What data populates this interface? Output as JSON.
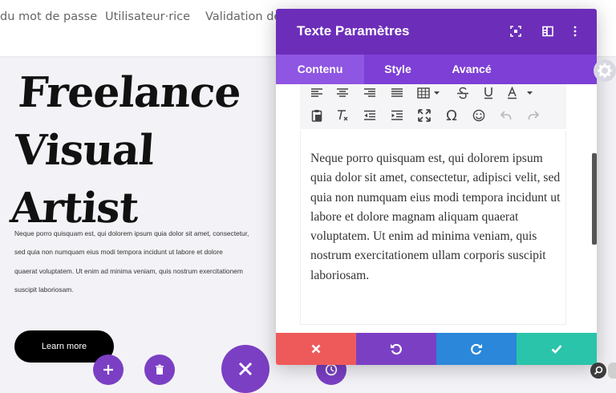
{
  "nav": {
    "items": [
      "du mot de passe",
      "Utilisateur·rice",
      "Validation de"
    ]
  },
  "page": {
    "hero_title_line1": "Freelance",
    "hero_title_line2": "Visual Artist",
    "hero_text": "Neque porro quisquam est, qui dolorem ipsum quia dolor sit amet, consectetur,\nsed quia non numquam eius modi tempora incidunt ut labore et dolore\nquaerat voluptatem. Ut enim ad minima veniam, quis nostrum exercitationem\nsuscipit laboriosam.",
    "learn_more": "Learn more"
  },
  "modal": {
    "title": "Texte Paramètres",
    "tabs": [
      {
        "label": "Contenu",
        "active": true
      },
      {
        "label": "Style",
        "active": false
      },
      {
        "label": "Avancé",
        "active": false
      }
    ],
    "toolbar_row1": [
      "align-left-icon",
      "align-center-icon",
      "align-right-icon",
      "align-justify-icon",
      "table-icon",
      "strikethrough-icon",
      "underline-icon",
      "text-color-icon"
    ],
    "toolbar_row2": [
      "paste-icon",
      "clear-format-icon",
      "outdent-icon",
      "indent-icon",
      "fullscreen-icon",
      "special-char-icon",
      "emoji-icon",
      "undo-icon",
      "redo-icon"
    ],
    "body_text": "Neque porro quisquam est, qui dolorem ipsum quia dolor sit amet, consectetur, adipisci velit, sed quia non numquam eius modi tempora incidunt ut labore et dolore magnam aliquam quaerat voluptatem. Ut enim ad minima veniam, quis nostrum exercitationem ullam corporis suscipit laboriosam.",
    "footer_colors": {
      "cancel": "#ee5a5a",
      "undo": "#7b3fc4",
      "redo": "#2b87da",
      "save": "#29c4a9"
    }
  },
  "colors": {
    "header": "#6c2eb9",
    "tabs": "#7d3fd6",
    "accent": "#7b3fc4"
  }
}
